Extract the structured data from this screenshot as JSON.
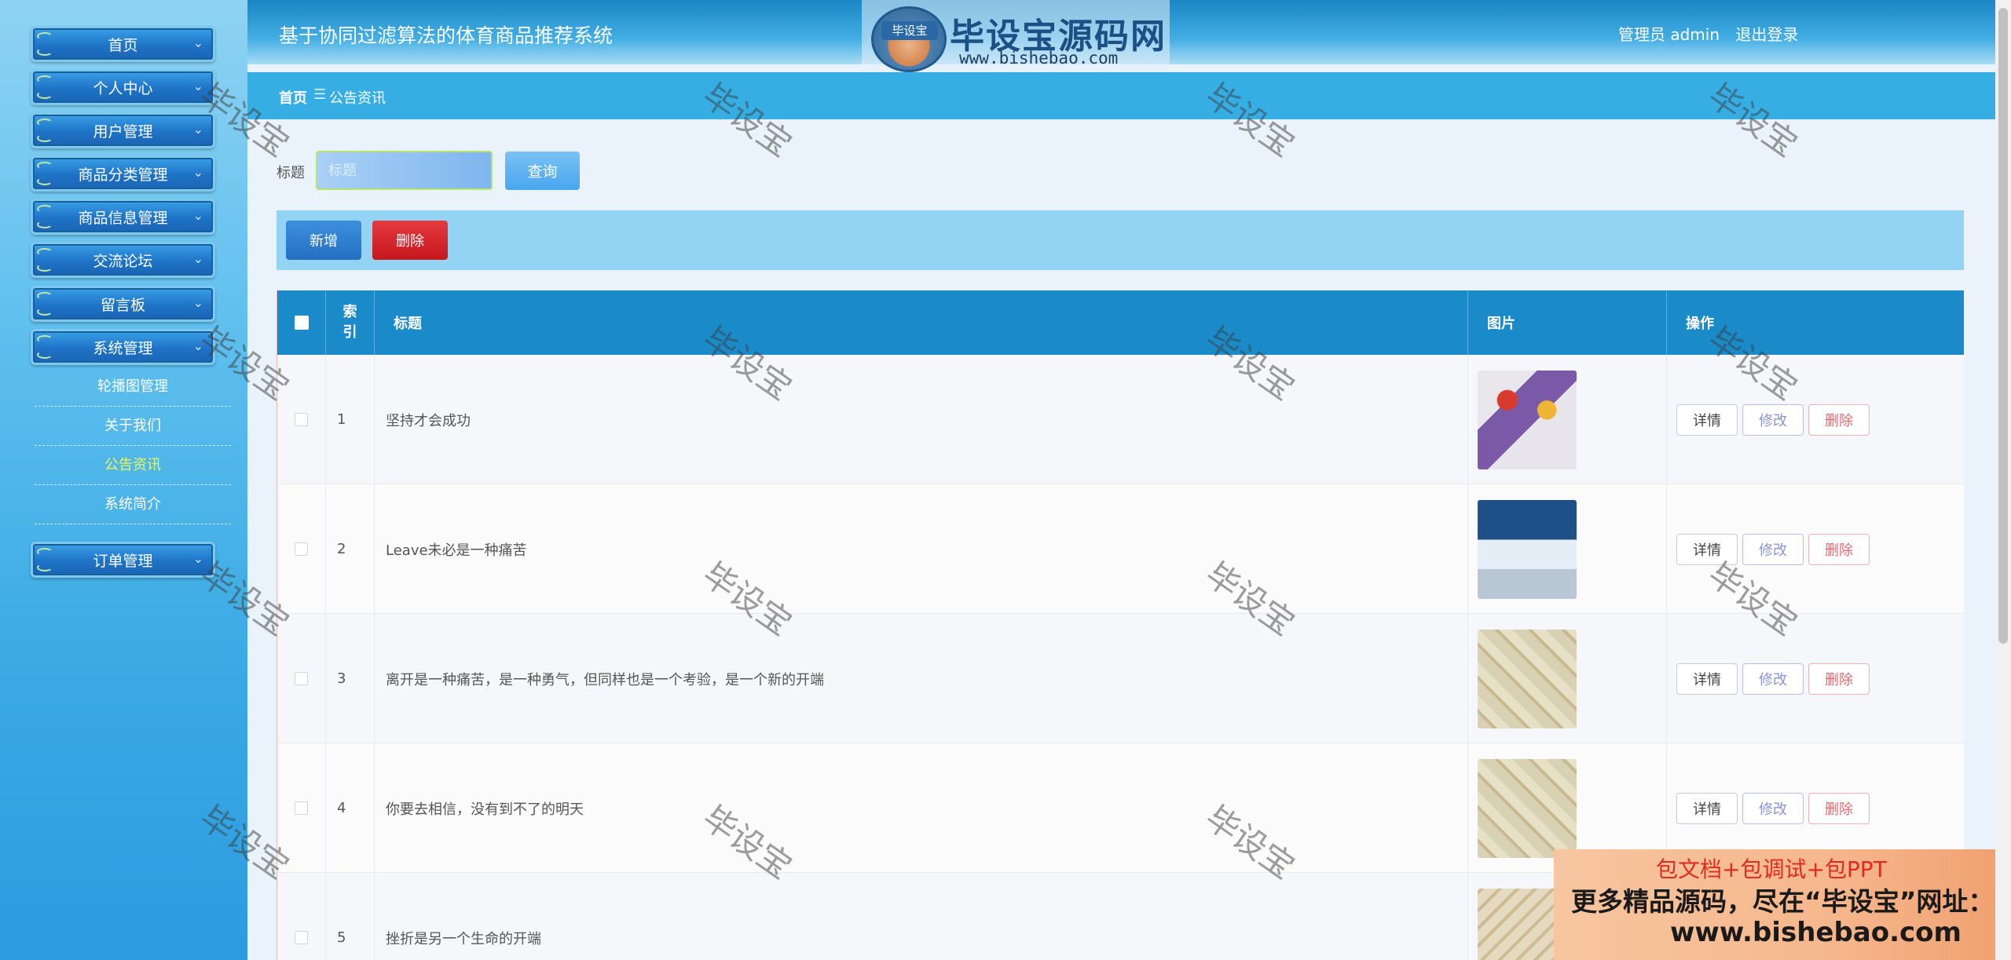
{
  "header": {
    "title": "基于协同过滤算法的体育商品推荐系统",
    "user_label": "管理员 admin",
    "logout_label": "退出登录"
  },
  "logo": {
    "badge": "毕设宝",
    "name": "毕设宝源码网",
    "url": "www.bishebao.com"
  },
  "sidebar": {
    "menu": [
      "首页",
      "个人中心",
      "用户管理",
      "商品分类管理",
      "商品信息管理",
      "交流论坛",
      "留言板",
      "系统管理"
    ],
    "system_submenu": [
      "轮播图管理",
      "关于我们",
      "公告资讯",
      "系统简介"
    ],
    "active_submenu": "公告资讯",
    "bottom_menu": "订单管理"
  },
  "breadcrumb": {
    "home": "首页",
    "separator": "☰",
    "current": "公告资讯"
  },
  "search": {
    "label": "标题",
    "placeholder": "标题",
    "button": "查询"
  },
  "actions": {
    "add": "新增",
    "delete": "删除"
  },
  "table": {
    "headers": {
      "index": "索引",
      "title": "标题",
      "image": "图片",
      "ops": "操作"
    },
    "rows": [
      {
        "index": "1",
        "title": "坚持才会成功"
      },
      {
        "index": "2",
        "title": "Leave未必是一种痛苦"
      },
      {
        "index": "3",
        "title": "离开是一种痛苦，是一种勇气，但同样也是一个考验，是一个新的开端"
      },
      {
        "index": "4",
        "title": "你要去相信，没有到不了的明天"
      },
      {
        "index": "5",
        "title": "挫折是另一个生命的开端"
      }
    ],
    "ops": {
      "detail": "详情",
      "edit": "修改",
      "delete": "删除"
    }
  },
  "watermark": "毕设宝",
  "ad": {
    "line1": "包文档+包调试+包PPT",
    "line2": "更多精品源码，尽在“毕设宝”网址：",
    "line3": "www.bishebao.com"
  }
}
